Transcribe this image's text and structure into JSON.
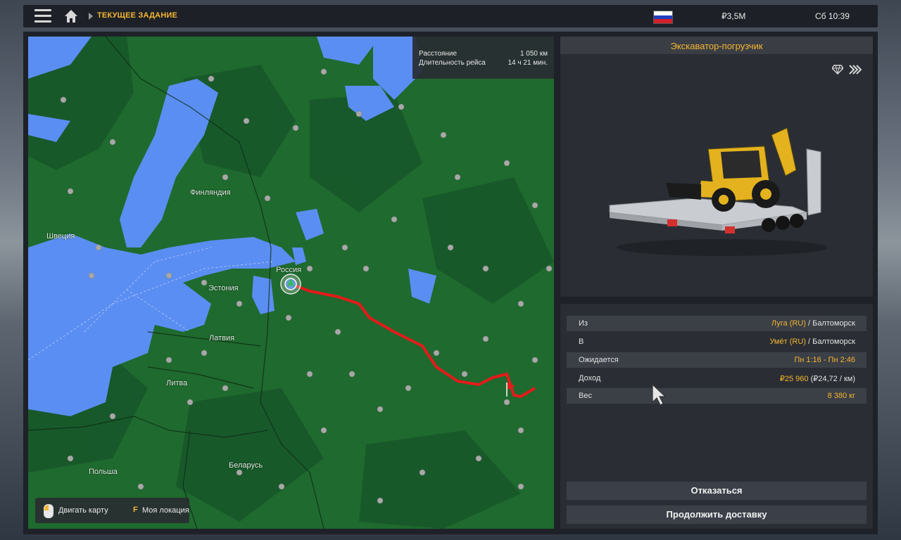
{
  "topbar": {
    "breadcrumb": "ТЕКУЩЕЕ ЗАДАНИЕ",
    "money": "₽3,5M",
    "clock": "Сб 10:39",
    "flag_colors": [
      "#ffffff",
      "#1f3fbf",
      "#d4202a"
    ]
  },
  "map": {
    "route_info": {
      "distance_label": "Расстояние",
      "distance_value": "1 050 км",
      "duration_label": "Длительность рейса",
      "duration_value": "14 ч 21 мин."
    },
    "countries": {
      "finland": "Финляндия",
      "sweden": "Швеция",
      "russia": "Россия",
      "estonia": "Эстония",
      "latvia": "Латвия",
      "lithuania": "Литва",
      "belarus": "Беларусь",
      "poland": "Польша"
    },
    "hints": {
      "move": "Двигать карту",
      "key": "F",
      "location": "Моя локация"
    },
    "colors": {
      "land": "#1f6a2e",
      "water": "#5b8ef2",
      "route": "#e31b1b"
    }
  },
  "cargo": {
    "title": "Экскаватор-погрузчик",
    "icons": [
      "diamond-icon",
      "fast-forward-icon"
    ]
  },
  "details": {
    "from_label": "Из",
    "from_city": "Луга (RU)",
    "from_company": "Балтоморск",
    "to_label": "В",
    "to_city": "Умёт (RU)",
    "to_company": "Балтоморск",
    "expected_label": "Ожидается",
    "expected_value": "Пн 1:16 - Пн 2:46",
    "income_label": "Доход",
    "income_value": "₽25 960",
    "income_rate": "(₽24,72 / км)",
    "weight_label": "Вес",
    "weight_value": "8 380 кг",
    "separator": " / "
  },
  "buttons": {
    "cancel": "Отказаться",
    "continue": "Продолжить доставку"
  },
  "accent_color": "#f5b531"
}
